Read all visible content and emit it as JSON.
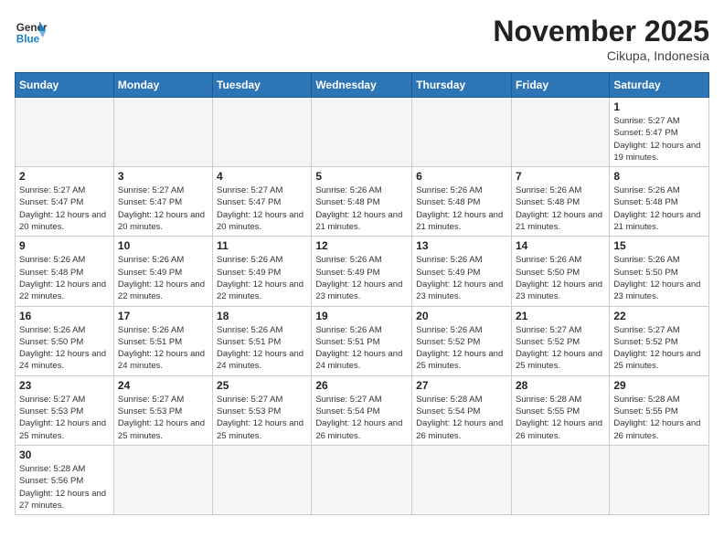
{
  "logo": {
    "line1": "General",
    "line2": "Blue"
  },
  "title": "November 2025",
  "subtitle": "Cikupa, Indonesia",
  "days_of_week": [
    "Sunday",
    "Monday",
    "Tuesday",
    "Wednesday",
    "Thursday",
    "Friday",
    "Saturday"
  ],
  "weeks": [
    [
      {
        "day": "",
        "info": ""
      },
      {
        "day": "",
        "info": ""
      },
      {
        "day": "",
        "info": ""
      },
      {
        "day": "",
        "info": ""
      },
      {
        "day": "",
        "info": ""
      },
      {
        "day": "",
        "info": ""
      },
      {
        "day": "1",
        "info": "Sunrise: 5:27 AM\nSunset: 5:47 PM\nDaylight: 12 hours and 19 minutes."
      }
    ],
    [
      {
        "day": "2",
        "info": "Sunrise: 5:27 AM\nSunset: 5:47 PM\nDaylight: 12 hours and 20 minutes."
      },
      {
        "day": "3",
        "info": "Sunrise: 5:27 AM\nSunset: 5:47 PM\nDaylight: 12 hours and 20 minutes."
      },
      {
        "day": "4",
        "info": "Sunrise: 5:27 AM\nSunset: 5:47 PM\nDaylight: 12 hours and 20 minutes."
      },
      {
        "day": "5",
        "info": "Sunrise: 5:26 AM\nSunset: 5:48 PM\nDaylight: 12 hours and 21 minutes."
      },
      {
        "day": "6",
        "info": "Sunrise: 5:26 AM\nSunset: 5:48 PM\nDaylight: 12 hours and 21 minutes."
      },
      {
        "day": "7",
        "info": "Sunrise: 5:26 AM\nSunset: 5:48 PM\nDaylight: 12 hours and 21 minutes."
      },
      {
        "day": "8",
        "info": "Sunrise: 5:26 AM\nSunset: 5:48 PM\nDaylight: 12 hours and 21 minutes."
      }
    ],
    [
      {
        "day": "9",
        "info": "Sunrise: 5:26 AM\nSunset: 5:48 PM\nDaylight: 12 hours and 22 minutes."
      },
      {
        "day": "10",
        "info": "Sunrise: 5:26 AM\nSunset: 5:49 PM\nDaylight: 12 hours and 22 minutes."
      },
      {
        "day": "11",
        "info": "Sunrise: 5:26 AM\nSunset: 5:49 PM\nDaylight: 12 hours and 22 minutes."
      },
      {
        "day": "12",
        "info": "Sunrise: 5:26 AM\nSunset: 5:49 PM\nDaylight: 12 hours and 23 minutes."
      },
      {
        "day": "13",
        "info": "Sunrise: 5:26 AM\nSunset: 5:49 PM\nDaylight: 12 hours and 23 minutes."
      },
      {
        "day": "14",
        "info": "Sunrise: 5:26 AM\nSunset: 5:50 PM\nDaylight: 12 hours and 23 minutes."
      },
      {
        "day": "15",
        "info": "Sunrise: 5:26 AM\nSunset: 5:50 PM\nDaylight: 12 hours and 23 minutes."
      }
    ],
    [
      {
        "day": "16",
        "info": "Sunrise: 5:26 AM\nSunset: 5:50 PM\nDaylight: 12 hours and 24 minutes."
      },
      {
        "day": "17",
        "info": "Sunrise: 5:26 AM\nSunset: 5:51 PM\nDaylight: 12 hours and 24 minutes."
      },
      {
        "day": "18",
        "info": "Sunrise: 5:26 AM\nSunset: 5:51 PM\nDaylight: 12 hours and 24 minutes."
      },
      {
        "day": "19",
        "info": "Sunrise: 5:26 AM\nSunset: 5:51 PM\nDaylight: 12 hours and 24 minutes."
      },
      {
        "day": "20",
        "info": "Sunrise: 5:26 AM\nSunset: 5:52 PM\nDaylight: 12 hours and 25 minutes."
      },
      {
        "day": "21",
        "info": "Sunrise: 5:27 AM\nSunset: 5:52 PM\nDaylight: 12 hours and 25 minutes."
      },
      {
        "day": "22",
        "info": "Sunrise: 5:27 AM\nSunset: 5:52 PM\nDaylight: 12 hours and 25 minutes."
      }
    ],
    [
      {
        "day": "23",
        "info": "Sunrise: 5:27 AM\nSunset: 5:53 PM\nDaylight: 12 hours and 25 minutes."
      },
      {
        "day": "24",
        "info": "Sunrise: 5:27 AM\nSunset: 5:53 PM\nDaylight: 12 hours and 25 minutes."
      },
      {
        "day": "25",
        "info": "Sunrise: 5:27 AM\nSunset: 5:53 PM\nDaylight: 12 hours and 25 minutes."
      },
      {
        "day": "26",
        "info": "Sunrise: 5:27 AM\nSunset: 5:54 PM\nDaylight: 12 hours and 26 minutes."
      },
      {
        "day": "27",
        "info": "Sunrise: 5:28 AM\nSunset: 5:54 PM\nDaylight: 12 hours and 26 minutes."
      },
      {
        "day": "28",
        "info": "Sunrise: 5:28 AM\nSunset: 5:55 PM\nDaylight: 12 hours and 26 minutes."
      },
      {
        "day": "29",
        "info": "Sunrise: 5:28 AM\nSunset: 5:55 PM\nDaylight: 12 hours and 26 minutes."
      }
    ],
    [
      {
        "day": "30",
        "info": "Sunrise: 5:28 AM\nSunset: 5:56 PM\nDaylight: 12 hours and 27 minutes."
      },
      {
        "day": "",
        "info": ""
      },
      {
        "day": "",
        "info": ""
      },
      {
        "day": "",
        "info": ""
      },
      {
        "day": "",
        "info": ""
      },
      {
        "day": "",
        "info": ""
      },
      {
        "day": "",
        "info": ""
      }
    ]
  ]
}
